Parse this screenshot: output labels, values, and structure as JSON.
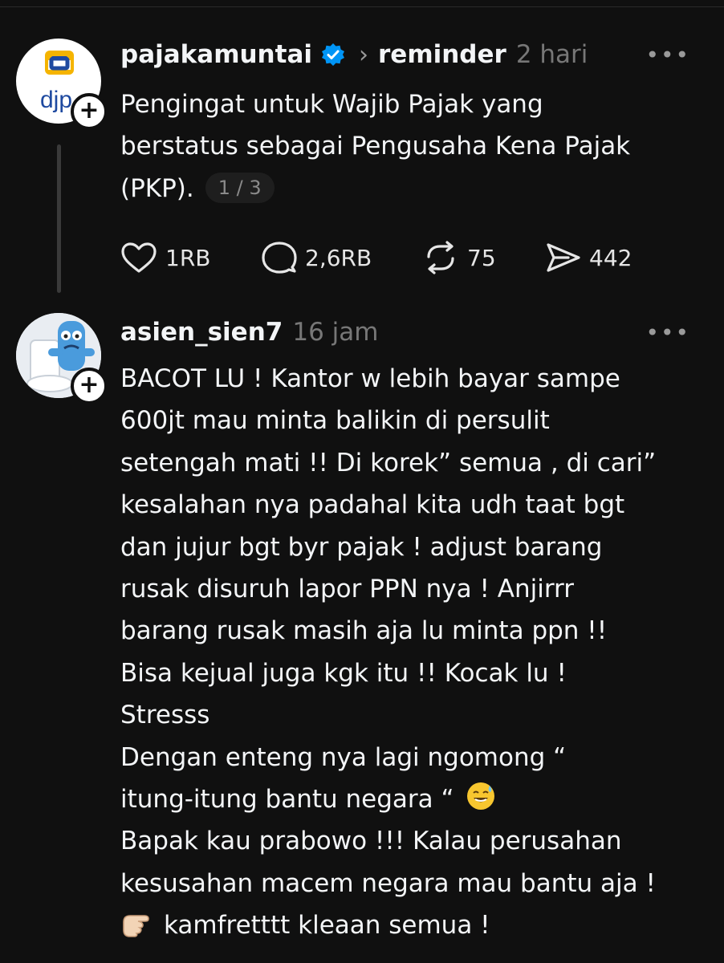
{
  "posts": [
    {
      "username": "pajakamuntai",
      "verified": true,
      "topic": "reminder",
      "time": "2 hari",
      "more": "•••",
      "avatar_text": "djp",
      "lines": [
        "Pengingat untuk Wajib Pajak yang",
        "berstatus sebagai Pengusaha Kena Pajak",
        "(PKP)."
      ],
      "pagination": "1 / 3",
      "actions": {
        "likes": "1RB",
        "comments": "2,6RB",
        "reposts": "75",
        "shares": "442"
      }
    },
    {
      "username": "asien_sien7",
      "time": "16 jam",
      "more": "•••",
      "lines": [
        "BACOT LU ! Kantor w lebih bayar sampe",
        "600jt mau minta balikin di persulit",
        "setengah mati !! Di korek” semua , di cari”",
        "kesalahan nya padahal kita udh taat bgt",
        "dan jujur bgt byr pajak ! adjust barang",
        "rusak disuruh lapor PPN nya ! Anjirrr",
        "barang rusak masih aja lu minta ppn !!",
        "Bisa kejual juga kgk itu !! Kocak lu !",
        "Stresss",
        "Dengan enteng nya lagi ngomong “",
        "itung-itung bantu negara “",
        "Bapak kau prabowo !!! Kalau perusahan",
        "kesusahan macem negara mau bantu aja !",
        "kamfretttt kleaan semua !"
      ],
      "emoji_after_line_11": "sweat-smile-emoji",
      "emoji_before_line_14": "pointing-hand-emoji"
    }
  ],
  "colors": {
    "background": "#101010",
    "text": "#f3f5f7",
    "muted": "#777777",
    "verified": "#0095f6"
  }
}
